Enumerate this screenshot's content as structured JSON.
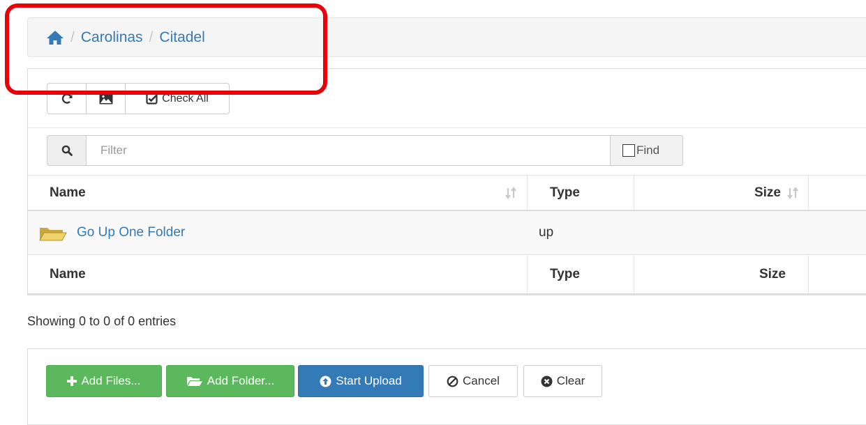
{
  "breadcrumb": {
    "home_icon": "home-icon",
    "separator": "/",
    "items": [
      "Carolinas",
      "Citadel"
    ]
  },
  "toolbar": {
    "refresh_icon": "refresh-icon",
    "image_icon": "image-icon",
    "check_all_label": "Check All"
  },
  "filter": {
    "placeholder": "Filter",
    "find_label": "Find",
    "find_checked": false
  },
  "table": {
    "columns": [
      "Name",
      "Type",
      "Size"
    ],
    "rows": [
      {
        "name": "Go Up One Folder",
        "type": "up",
        "size": ""
      }
    ]
  },
  "entries_info": "Showing 0 to 0 of 0 entries",
  "upload": {
    "add_files": "Add Files...",
    "add_folder": "Add Folder...",
    "start_upload": "Start Upload",
    "cancel": "Cancel",
    "clear": "Clear"
  },
  "colors": {
    "link": "#337ab7",
    "success": "#5cb85c",
    "primary": "#337ab7",
    "highlight": "#e8000b"
  }
}
